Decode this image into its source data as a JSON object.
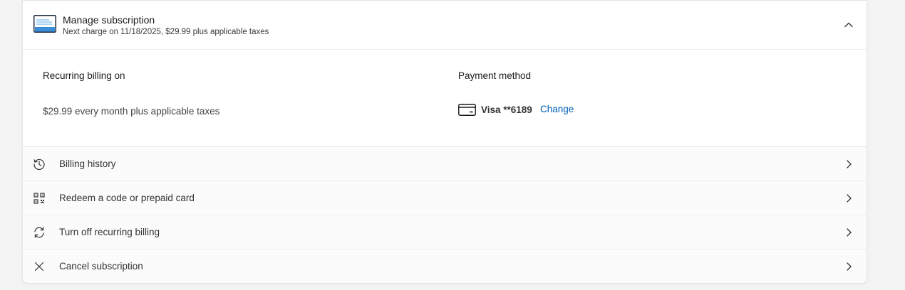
{
  "subscription": {
    "title": "Manage subscription",
    "next_charge": "Next charge on 11/18/2025, $29.99 plus applicable taxes",
    "icon": "subscription-card-icon",
    "expanded_icon": "chevron-up-icon"
  },
  "billing": {
    "recurring_label": "Recurring billing on",
    "recurring_value": "$29.99 every month plus applicable taxes",
    "payment_label": "Payment method",
    "payment_card": "Visa **6189",
    "payment_icon": "credit-card-icon",
    "change_label": "Change"
  },
  "actions": [
    {
      "label": "Billing history",
      "icon": "history-icon"
    },
    {
      "label": "Redeem a code or prepaid card",
      "icon": "qr-code-icon"
    },
    {
      "label": "Turn off recurring billing",
      "icon": "sync-icon"
    },
    {
      "label": "Cancel subscription",
      "icon": "close-icon"
    }
  ],
  "colors": {
    "accent": "#005fb8",
    "background": "#f3f3f3",
    "card": "#ffffff"
  }
}
